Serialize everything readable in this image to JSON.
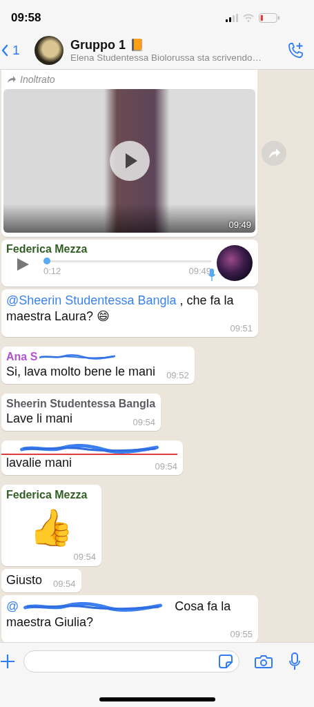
{
  "status_bar": {
    "time": "09:58"
  },
  "header": {
    "back_count": "1",
    "title": "Gruppo 1",
    "title_emoji": "📙",
    "subtitle": "Elena Studentessa Biolorussa sta scrivendo…"
  },
  "messages": [
    {
      "kind": "video",
      "forwarded_label": "Inoltrato",
      "time": "09:49"
    },
    {
      "kind": "voice",
      "sender": "Federica Mezza",
      "color": "#2f5e22",
      "duration": "0:12",
      "time": "09:49",
      "level": 0
    },
    {
      "kind": "text",
      "mention": "@Sheerin Studentessa Bangla",
      "text": " , che fa la maestra Laura? 😄",
      "time": "09:51"
    },
    {
      "kind": "text",
      "sender": "Ana S",
      "sender_redacted": true,
      "color": "#b64fd8",
      "text": "Si, lava molto bene le mani",
      "time": "09:52"
    },
    {
      "kind": "text",
      "sender": "Sheerin Studentessa Bangla",
      "color": "#5b5b62",
      "text": "Lave li mani",
      "time": "09:54"
    },
    {
      "kind": "text",
      "sender_redacted": true,
      "color": "#e23b3b",
      "text": "lavalie mani",
      "time": "09:54"
    },
    {
      "kind": "sticker",
      "sender": "Federica Mezza",
      "color": "#2f5e22",
      "emoji": "👍",
      "time": "09:54"
    },
    {
      "kind": "text",
      "text": "Giusto",
      "time": "09:54"
    },
    {
      "kind": "text",
      "mention": "@",
      "mention_redacted": true,
      "text": " Cosa fa la maestra Giulia?",
      "time": "09:55"
    }
  ]
}
